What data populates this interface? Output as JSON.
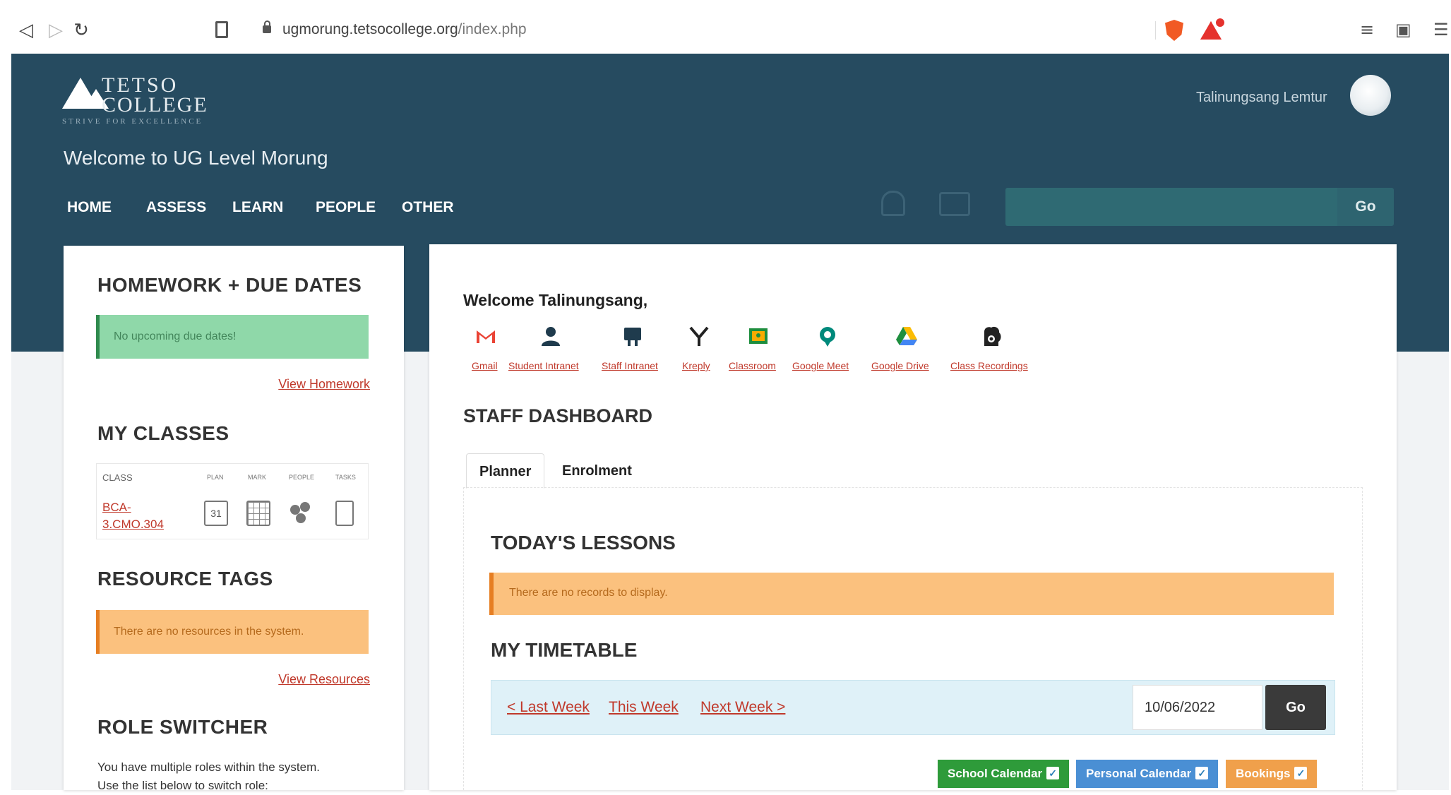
{
  "browser": {
    "url_host": "ugmorung.tetsocollege.org",
    "url_path": "/index.php"
  },
  "header": {
    "logo_line1": "TETSO",
    "logo_line2": "COLLEGE",
    "logo_tagline": "STRIVE FOR EXCELLENCE",
    "user_name": "Talinungsang Lemtur",
    "welcome": "Welcome to UG Level Morung",
    "nav": [
      "HOME",
      "ASSESS",
      "LEARN",
      "PEOPLE",
      "OTHER"
    ],
    "search_value": "",
    "search_go": "Go"
  },
  "sidebar": {
    "homework_title": "HOMEWORK + DUE DATES",
    "homework_alert": "No upcoming due dates!",
    "homework_link": "View Homework",
    "classes_title": "MY CLASSES",
    "classes_headers": [
      "CLASS",
      "PLAN",
      "MARK",
      "PEOPLE",
      "TASKS"
    ],
    "class_name": "BCA-3.CMO.304",
    "calendar_day": "31",
    "resources_title": "RESOURCE TAGS",
    "resources_alert": "There are no resources in the system.",
    "resources_link": "View Resources",
    "role_title": "ROLE SWITCHER",
    "role_text_1": "You have multiple roles within the system.",
    "role_text_2": "Use the list below to switch role:"
  },
  "main": {
    "welcome": "Welcome Talinungsang,",
    "apps": [
      {
        "label": "Gmail",
        "icon": "gmail-icon",
        "color": "#ea4335"
      },
      {
        "label": "Student Intranet",
        "icon": "student-icon",
        "color": "#1f3b4d"
      },
      {
        "label": "Staff Intranet",
        "icon": "staff-icon",
        "color": "#1f3b4d"
      },
      {
        "label": "Kreply",
        "icon": "kreply-icon",
        "color": "#222222"
      },
      {
        "label": "Classroom",
        "icon": "classroom-icon",
        "color": "#1e8e3e"
      },
      {
        "label": "Google Meet",
        "icon": "meet-icon",
        "color": "#00897b"
      },
      {
        "label": "Google Drive",
        "icon": "drive-icon",
        "color": "#fbbc04"
      },
      {
        "label": "Class Recordings",
        "icon": "recordings-icon",
        "color": "#222222"
      }
    ],
    "dashboard_title": "STAFF DASHBOARD",
    "tabs": [
      "Planner",
      "Enrolment"
    ],
    "lessons_title": "TODAY'S LESSONS",
    "lessons_alert": "There are no records to display.",
    "timetable_title": "MY TIMETABLE",
    "last_week": "< Last Week",
    "this_week": "This Week",
    "next_week": "Next Week >",
    "date_value": "10/06/2022",
    "timetable_go": "Go",
    "calendars": [
      {
        "label": "School Calendar",
        "color": "#2e9b3a"
      },
      {
        "label": "Personal Calendar",
        "color": "#4a8fd4"
      },
      {
        "label": "Bookings",
        "color": "#f0a04b"
      }
    ]
  }
}
